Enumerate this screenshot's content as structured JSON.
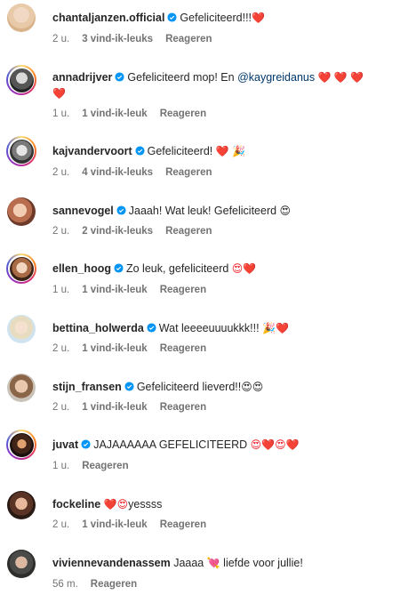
{
  "comments": [
    {
      "user": "chantaljanzen.official",
      "text": "Gefeliciteerd!!!",
      "emoji": "❤️",
      "time": "2 u.",
      "likes": "3 vind-ik-leuks",
      "reply": "Reageren",
      "ring": false
    },
    {
      "user": "annadrijver",
      "text": "Gefeliciteerd mop! En ",
      "mention": "@kaygreidanus",
      "emoji": "❤️ ❤️ ❤️",
      "emoji2": "❤️",
      "time": "1 u.",
      "likes": "1 vind-ik-leuk",
      "reply": "Reageren",
      "ring": true
    },
    {
      "user": "kajvandervoort",
      "text": "Gefeliciteerd! ",
      "emoji": "❤️ 🎉",
      "time": "2 u.",
      "likes": "4 vind-ik-leuks",
      "reply": "Reageren",
      "ring": true
    },
    {
      "user": "sannevogel",
      "text": "Jaaah! Wat leuk! Gefeliciteerd ",
      "emoji": "😍",
      "time": "2 u.",
      "likes": "2 vind-ik-leuks",
      "reply": "Reageren",
      "ring": false
    },
    {
      "user": "ellen_hoog",
      "text": "Zo leuk, gefeliciteerd ",
      "emoji": "😍❤️",
      "time": "1 u.",
      "likes": "1 vind-ik-leuk",
      "reply": "Reageren",
      "ring": true
    },
    {
      "user": "bettina_holwerda",
      "text": "Wat leeeeuuuukkk!!! ",
      "emoji": "🎉❤️",
      "time": "2 u.",
      "likes": "1 vind-ik-leuk",
      "reply": "Reageren",
      "ring": false
    },
    {
      "user": "stijn_fransen",
      "text": "Gefeliciteerd lieverd!!",
      "emoji": "😍😍",
      "time": "2 u.",
      "likes": "1 vind-ik-leuk",
      "reply": "Reageren",
      "ring": false
    },
    {
      "user": "juvat",
      "text": "JAJAAAAAA GEFELICITEERD ",
      "emoji": "😍❤️😍❤️",
      "time": "1 u.",
      "likes": "",
      "reply": "Reageren",
      "ring": true
    },
    {
      "user": "fockeline",
      "text": "yessss",
      "emoji": "❤️😍",
      "time": "2 u.",
      "likes": "1 vind-ik-leuk",
      "reply": "Reageren",
      "ring": false,
      "emoji_first": true
    },
    {
      "user": "viviennevandenassem",
      "text": "Jaaaa ",
      "emoji": "💘",
      "text2": " liefde voor jullie!",
      "time": "56 m.",
      "likes": "",
      "reply": "Reageren",
      "ring": false
    }
  ],
  "colors": {
    "ring_start": "#feda75",
    "ring_end": "#4f5bd5",
    "verified": "#0095f6",
    "heart": "#ed1c24",
    "muted": "#737373"
  }
}
